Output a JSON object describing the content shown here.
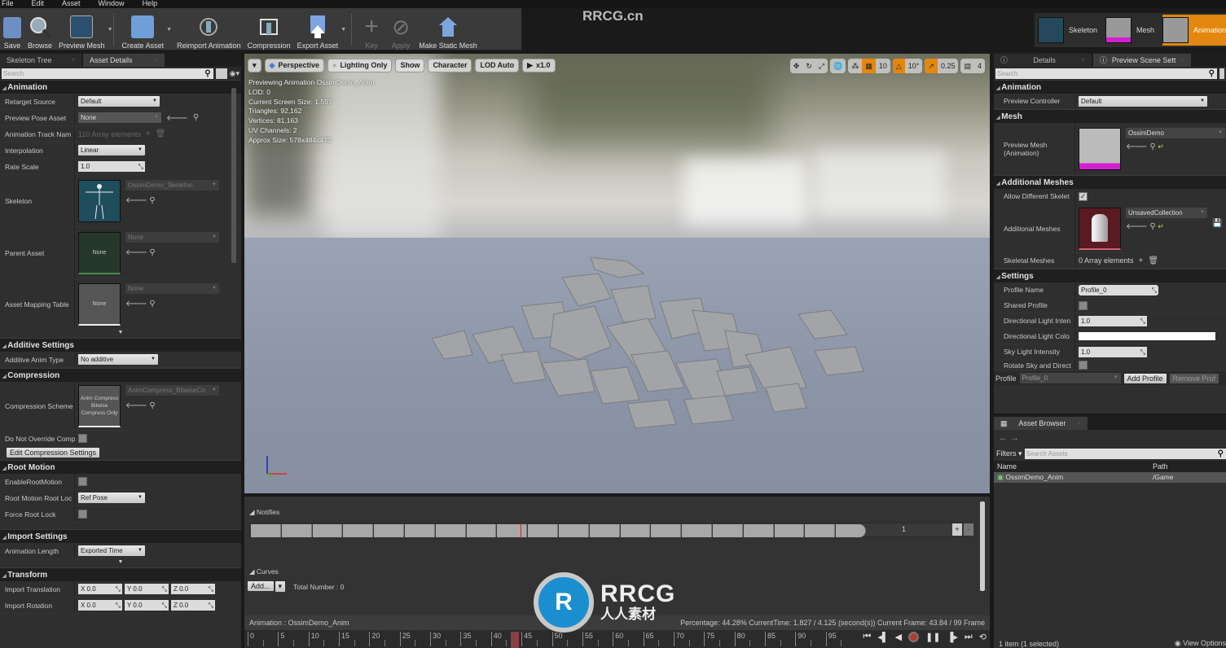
{
  "menu": [
    "File",
    "Edit",
    "Asset",
    "Window",
    "Help"
  ],
  "toolbar": [
    {
      "label": "Save",
      "icon": "save-icon",
      "disabled": false
    },
    {
      "label": "Browse",
      "icon": "browse-icon",
      "disabled": false
    },
    {
      "label": "Preview Mesh",
      "icon": "preview-mesh-icon",
      "disabled": false,
      "dropdown": true
    },
    {
      "label": "Create Asset",
      "icon": "create-asset-icon",
      "disabled": false,
      "dropdown": true
    },
    {
      "label": "Reimport Animation",
      "icon": "reimport-icon",
      "disabled": false
    },
    {
      "label": "Compression",
      "icon": "compression-icon",
      "disabled": false
    },
    {
      "label": "Export Asset",
      "icon": "export-icon",
      "disabled": false,
      "dropdown": true
    },
    {
      "label": "Key",
      "icon": "key-plus-icon",
      "disabled": true
    },
    {
      "label": "Apply",
      "icon": "apply-icon",
      "disabled": true
    },
    {
      "label": "Make Static Mesh",
      "icon": "static-mesh-icon",
      "disabled": false
    }
  ],
  "watermark_top": "RRCG.cn",
  "modes": [
    {
      "label": "Skeleton",
      "active": false
    },
    {
      "label": "Mesh",
      "active": false
    },
    {
      "label": "Animation",
      "active": true
    }
  ],
  "left_panel": {
    "tabs": [
      {
        "label": "Skeleton Tree",
        "active": false
      },
      {
        "label": "Asset Details",
        "active": true
      }
    ],
    "search_placeholder": "Search",
    "animation": {
      "title": "Animation",
      "retarget_source": {
        "label": "Retarget Source",
        "value": "Default"
      },
      "preview_pose_asset": {
        "label": "Preview Pose Asset",
        "value": "None"
      },
      "animation_track_names": {
        "label": "Animation Track Nam",
        "value": "110 Array elements"
      },
      "interpolation": {
        "label": "Interpolation",
        "value": "Linear"
      },
      "rate_scale": {
        "label": "Rate Scale",
        "value": "1.0"
      },
      "skeleton": {
        "label": "Skeleton",
        "value": "OssimDemo_Skeleton"
      },
      "parent_asset": {
        "label": "Parent Asset",
        "value": "None",
        "thumb": "None"
      },
      "asset_mapping_table": {
        "label": "Asset Mapping Table",
        "value": "None",
        "thumb": "None"
      }
    },
    "additive": {
      "title": "Additive Settings",
      "type_label": "Additive Anim Type",
      "type_value": "No additive"
    },
    "compression": {
      "title": "Compression",
      "scheme_label": "Compression Scheme",
      "scheme_thumb": "Anim Compress Bitwise Compress Only",
      "scheme_value": "AnimCompress_BitwiseCo",
      "override_label": "Do Not Override Comp",
      "edit_button": "Edit Compression Settings"
    },
    "root_motion": {
      "title": "Root Motion",
      "enable_label": "EnableRootMotion",
      "root_lock_label": "Root Motion Root Loc",
      "root_lock_value": "Ref Pose",
      "force_lock_label": "Force Root Lock"
    },
    "import_settings": {
      "title": "Import Settings",
      "length_label": "Animation Length",
      "length_value": "Exported Time"
    },
    "transform": {
      "title": "Transform",
      "translation_label": "Import Translation",
      "translation": {
        "x": "X 0.0",
        "y": "Y 0.0",
        "z": "Z 0.0"
      },
      "rotation_label": "Import Rotation",
      "rotation": {
        "x": "X 0.0",
        "y": "Y 0.0",
        "z": "Z 0.0"
      }
    }
  },
  "viewport": {
    "buttons": [
      "Perspective",
      "Lighting Only",
      "Show",
      "Character",
      "LOD Auto",
      "x1.0"
    ],
    "grid_snap": "10",
    "rotation_snap": "10°",
    "scale_snap": "0.25",
    "camera_speed": "4",
    "info": [
      "Previewing Animation OssimDemo_Anim",
      "LOD: 0",
      "Current Screen Size: 1.597",
      "Triangles: 92,162",
      "Vertices: 81,163",
      "UV Channels: 2",
      "Approx Size: 578x484x472"
    ]
  },
  "timeline": {
    "notifies_label": "Notifies",
    "track_count": "1",
    "curves_label": "Curves",
    "add_button": "Add...",
    "total_number": "Total Number : 0",
    "animation_label": "Animation :  OssimDemo_Anim",
    "status": "Percentage: 44.28% CurrentTime: 1.827 / 4.125 (second(s)) Current Frame: 43.84 / 99 Frame",
    "percentage": 0.4428,
    "ruler_ticks": [
      "0",
      "5",
      "10",
      "15",
      "20",
      "25",
      "30",
      "35",
      "40",
      "45",
      "50",
      "55",
      "60",
      "65",
      "70",
      "75",
      "80",
      "85",
      "90",
      "95"
    ],
    "total_frames": 99,
    "current_frame": 43.84
  },
  "right_panel": {
    "tabs": [
      {
        "label": "Details",
        "active": false
      },
      {
        "label": "Preview Scene Sett",
        "active": true
      }
    ],
    "search_placeholder": "Search",
    "animation": {
      "title": "Animation",
      "controller_label": "Preview Controller",
      "controller_value": "Default"
    },
    "mesh": {
      "title": "Mesh",
      "preview_label": "Preview Mesh (Animation)",
      "preview_value": "OssimDemo"
    },
    "additional": {
      "title": "Additional Meshes",
      "allow_label": "Allow Different Skelet",
      "meshes_label": "Additional Meshes",
      "meshes_value": "UnsavedCollection",
      "skeletal_label": "Skeletal Meshes",
      "skeletal_value": "0 Array elements"
    },
    "settings": {
      "title": "Settings",
      "profile_name_label": "Profile Name",
      "profile_name": "Profile_0",
      "shared_label": "Shared Profile",
      "dir_int_label": "Directional Light Inten",
      "dir_int": "1.0",
      "dir_color_label": "Directional Light Colo",
      "sky_label": "Sky Light Intensity",
      "sky": "1.0",
      "rotate_label": "Rotate Sky and Direct"
    },
    "profile_bar": {
      "label": "Profile",
      "value": "Profile_0",
      "add": "Add Profile",
      "remove": "Remove Prof"
    }
  },
  "asset_browser": {
    "tab": "Asset Browser",
    "filters": "Filters",
    "search_placeholder": "Search Assets",
    "col_name": "Name",
    "col_path": "Path",
    "rows": [
      {
        "name": "OssimDemo_Anim",
        "path": "/Game"
      }
    ],
    "footer": "1 item (1 selected)",
    "view_options": "View Options"
  },
  "watermark": {
    "logo": "R",
    "title": "RRCG",
    "subtitle": "人人素材"
  }
}
